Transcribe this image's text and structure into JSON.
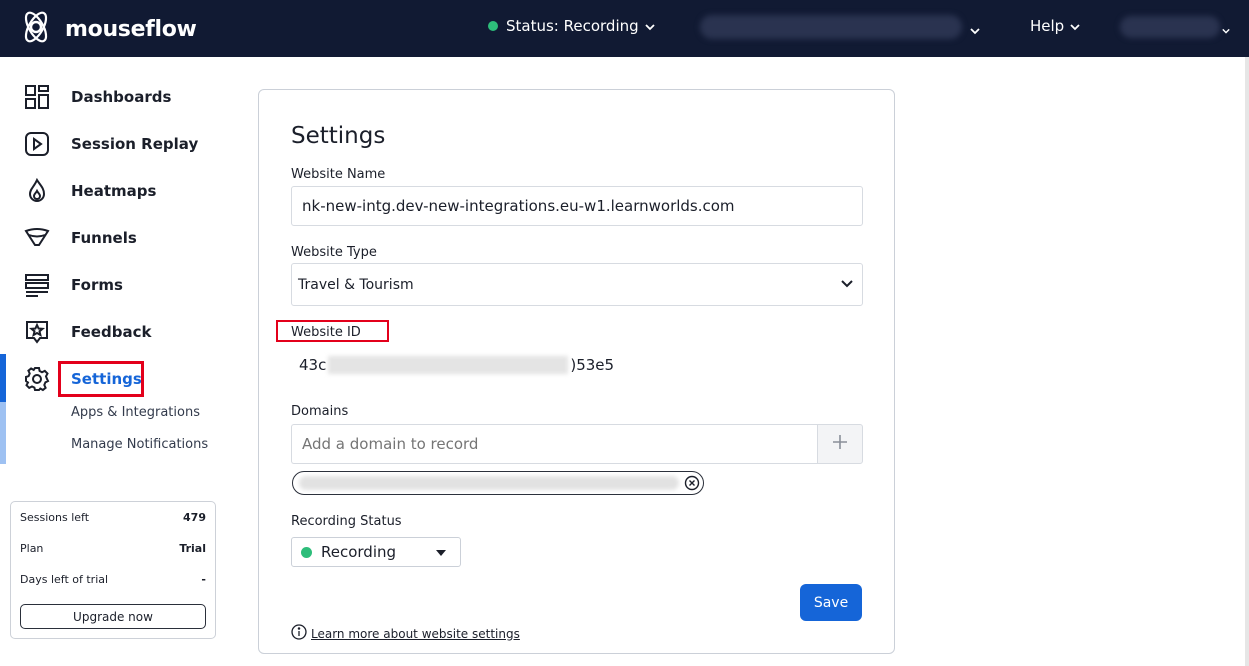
{
  "topbar": {
    "brand": "mouseflow",
    "status_label": "Status: Recording",
    "status_color": "#2dbd7a",
    "help_label": "Help"
  },
  "sidebar": {
    "items": [
      {
        "label": "Dashboards",
        "icon": "dashboard-grid-icon"
      },
      {
        "label": "Session Replay",
        "icon": "play-icon"
      },
      {
        "label": "Heatmaps",
        "icon": "flame-icon"
      },
      {
        "label": "Funnels",
        "icon": "funnel-icon"
      },
      {
        "label": "Forms",
        "icon": "form-icon"
      },
      {
        "label": "Feedback",
        "icon": "star-badge-icon"
      },
      {
        "label": "Settings",
        "icon": "gear-icon",
        "active": true
      }
    ],
    "subitems": [
      {
        "label": "Apps & Integrations"
      },
      {
        "label": "Manage Notifications"
      }
    ],
    "accent_color": "#1565d8"
  },
  "usage": {
    "rows": [
      {
        "label": "Sessions left",
        "value": "479"
      },
      {
        "label": "Plan",
        "value": "Trial"
      },
      {
        "label": "Days left of trial",
        "value": "-"
      }
    ],
    "upgrade_label": "Upgrade now"
  },
  "settings": {
    "title": "Settings",
    "website_name_label": "Website Name",
    "website_name_value": "nk-new-intg.dev-new-integrations.eu-w1.learnworlds.com",
    "website_type_label": "Website Type",
    "website_type_value": "Travel & Tourism",
    "website_id_label": "Website ID",
    "website_id_prefix": "43c",
    "website_id_suffix": ")53e5",
    "domains_label": "Domains",
    "domain_placeholder": "Add a domain to record",
    "recording_status_label": "Recording Status",
    "recording_status_value": "Recording",
    "save_label": "Save",
    "learn_more_label": "Learn more about website settings"
  }
}
